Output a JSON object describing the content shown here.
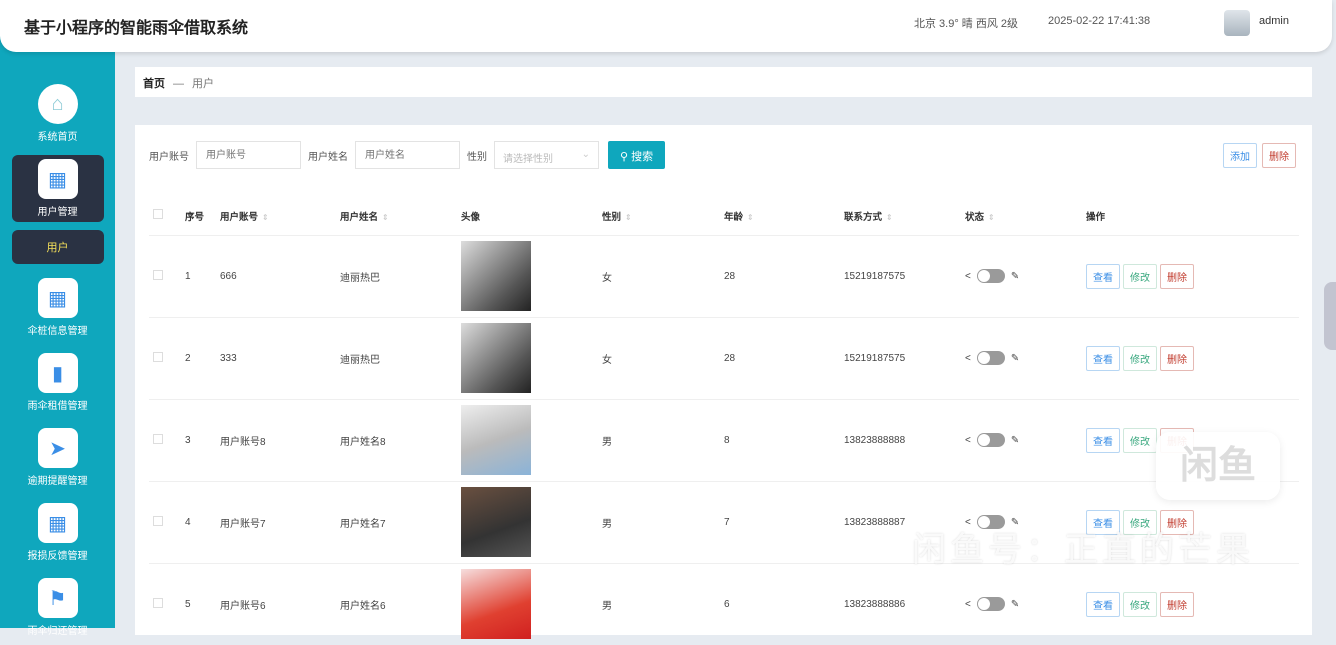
{
  "header": {
    "title": "基于小程序的智能雨伞借取系统",
    "weather": "北京 3.9° 晴 西风 2级",
    "datetime": "2025-02-22 17:41:38",
    "user": "admin"
  },
  "sidebar": {
    "items": [
      {
        "label": "系统首页",
        "icon": "home-icon"
      },
      {
        "label": "用户管理",
        "icon": "grid-icon",
        "active": true
      },
      {
        "label": "伞桩信息管理",
        "icon": "grid-icon"
      },
      {
        "label": "雨伞租借管理",
        "icon": "bar-chart-icon"
      },
      {
        "label": "逾期提醒管理",
        "icon": "paper-plane-icon"
      },
      {
        "label": "报损反馈管理",
        "icon": "grid-icon"
      },
      {
        "label": "雨伞归还管理",
        "icon": "flag-icon"
      }
    ],
    "sub_item": "用户"
  },
  "breadcrumb": {
    "home": "首页",
    "sep": "—",
    "current": "用户"
  },
  "search": {
    "account_label": "用户账号",
    "account_placeholder": "用户账号",
    "name_label": "用户姓名",
    "name_placeholder": "用户姓名",
    "gender_label": "性别",
    "gender_placeholder": "请选择性别",
    "search_button": "搜索"
  },
  "toolbar": {
    "add": "添加",
    "delete": "删除"
  },
  "table": {
    "headers": [
      "序号",
      "用户账号",
      "用户姓名",
      "头像",
      "性别",
      "年龄",
      "联系方式",
      "状态",
      "操作"
    ],
    "rows": [
      {
        "no": "1",
        "account": "666",
        "name": "迪丽热巴",
        "gender": "女",
        "age": "28",
        "phone": "15219187575"
      },
      {
        "no": "2",
        "account": "333",
        "name": "迪丽热巴",
        "gender": "女",
        "age": "28",
        "phone": "15219187575"
      },
      {
        "no": "3",
        "account": "用户账号8",
        "name": "用户姓名8",
        "gender": "男",
        "age": "8",
        "phone": "13823888888"
      },
      {
        "no": "4",
        "account": "用户账号7",
        "name": "用户姓名7",
        "gender": "男",
        "age": "7",
        "phone": "13823888887"
      },
      {
        "no": "5",
        "account": "用户账号6",
        "name": "用户姓名6",
        "gender": "男",
        "age": "6",
        "phone": "13823888886"
      }
    ],
    "actions": {
      "view": "查看",
      "edit": "修改",
      "delete": "删除"
    }
  },
  "watermark": {
    "logo": "闲鱼",
    "text": "闲鱼号：正直的芒果"
  }
}
